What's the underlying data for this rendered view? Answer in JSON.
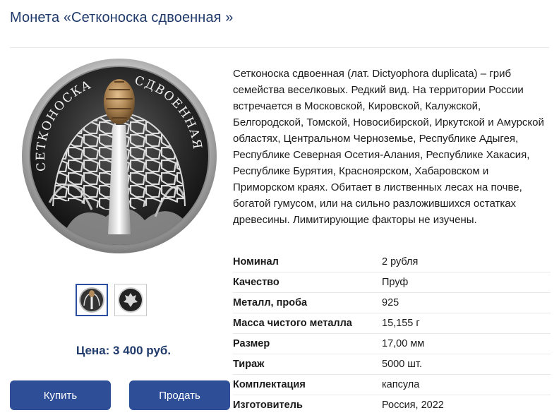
{
  "page": {
    "title": "Монета «Сетконоска сдвоенная »"
  },
  "coin": {
    "inscription_left": "СЕТКОНОСКА",
    "inscription_right": "СДВОЕННАЯ",
    "icons": [
      "coin-reverse-image",
      "coin-obverse-image"
    ]
  },
  "gallery": {
    "thumbnails": [
      {
        "name": "reverse"
      },
      {
        "name": "obverse"
      }
    ]
  },
  "price": {
    "text": "Цена: 3 400 руб."
  },
  "actions": {
    "buy_label": "Купить",
    "sell_label": "Продать"
  },
  "description": "Сетконоска сдвоенная (лат. Dictyophora duplicata) – гриб семейства веселковых. Редкий вид. На территории России встречается в Московской, Кировской, Калужской, Белгородской, Томской, Новосибирской, Иркутской и Амурской областях, Центральном Черноземье, Республике Адыгея, Республике Северная Осетия-Алания, Республике Хакасия, Республике Бурятия, Красноярском, Хабаровском и Приморском краях. Обитает в лиственных лесах на почве, богатой гумусом, или на сильно разложившихся остатках древесины. Лимитирующие факторы не изучены.",
  "specs": [
    {
      "label": "Номинал",
      "value": "2 рубля"
    },
    {
      "label": "Качество",
      "value": "Пруф"
    },
    {
      "label": "Металл, проба",
      "value": "925"
    },
    {
      "label": "Масса чистого металла",
      "value": "15,155 г"
    },
    {
      "label": "Размер",
      "value": "17,00 мм"
    },
    {
      "label": "Тираж",
      "value": "5000 шт."
    },
    {
      "label": "Комплектация",
      "value": "капсула"
    },
    {
      "label": "Изготовитель",
      "value": "Россия, 2022"
    }
  ],
  "colors": {
    "accent": "#2e4e98",
    "heading": "#1f3a6b",
    "cap": "#b08a5a"
  }
}
